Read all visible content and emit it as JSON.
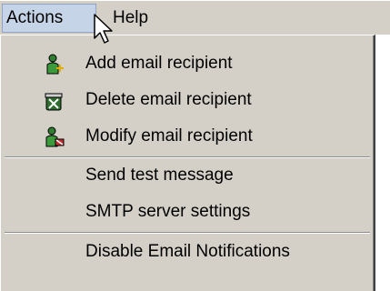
{
  "menubar": {
    "items": [
      {
        "label": "Actions"
      },
      {
        "label": "Help"
      }
    ]
  },
  "menu": {
    "items": [
      {
        "label": "Add email recipient",
        "icon": "add-user-icon"
      },
      {
        "label": "Delete email recipient",
        "icon": "delete-user-icon"
      },
      {
        "label": "Modify email recipient",
        "icon": "modify-user-icon"
      },
      {
        "label": "Send test message"
      },
      {
        "label": "SMTP server settings"
      },
      {
        "label": "Disable Email Notifications"
      }
    ]
  },
  "colors": {
    "menu_bg": "#d4d0c8",
    "active_highlight": "#c6d4e8"
  }
}
